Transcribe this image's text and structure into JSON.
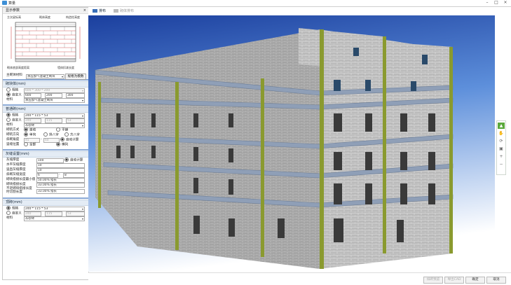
{
  "window": {
    "title": "算量"
  },
  "panel": {
    "title": "显示参数",
    "close": "×",
    "diagram_labels": {
      "top_left": "主次梁标高",
      "top_center": "砌体高度",
      "top_right": "构造柱高度",
      "bottom_left": "砌体底部高度距离",
      "bottom_right": "墙体扣减长度"
    },
    "material_label": "主砌体材料",
    "material_value": "蒸压加气混凝土砌块",
    "material_button": "规格为模数",
    "sections": {
      "masonry": {
        "title": "砌块体(mm)",
        "spec_label": "规格",
        "spec_value": "600 * 300 * 200",
        "custom_label": "自定义",
        "custom_values": [
          "600",
          "200",
          "300"
        ],
        "material_label": "材料",
        "material_value": "蒸压加气混凝土砌块"
      },
      "brick": {
        "title": "普通砖(mm)",
        "spec_label": "规格",
        "spec_value": "240 * 115 * 53",
        "custom_label": "自定义",
        "custom_values": [
          "240",
          "115",
          "53"
        ],
        "material_label": "材料",
        "material_value": "灰砂砖",
        "mode_label": "砌筑方式",
        "mode_options": [
          "自动",
          "平铺"
        ],
        "dir_label": "砌筑方向",
        "dir_options": [
          "单向",
          "斜八字",
          "方八字"
        ],
        "angle_label": "斜砌角度",
        "angle_from": "45",
        "angle_to": "60",
        "angle_auto": "自动计算",
        "layer_label": "竖缝位置",
        "layer_options": [
          "全部",
          "横列"
        ]
      },
      "mortar": {
        "title": "灰缝设置(mm)",
        "rows": [
          {
            "label": "灰缝厚度",
            "value": "100",
            "extra": "自动计算"
          },
          {
            "label": "水平灰缝厚度",
            "value": "10"
          },
          {
            "label": "竖直灰缝厚度",
            "value": "10"
          },
          {
            "label": "斜砌灰缝宽度",
            "value": "6",
            "to": "8"
          },
          {
            "label": "砌块搭接长度最小值",
            "value": "50.00% 搭长"
          },
          {
            "label": "砌块搭接长度",
            "value": "33.00% 搭长"
          },
          {
            "label": "不足砌块搭接长度时切割长度",
            "value": "33.00% 搭长"
          }
        ]
      },
      "top": {
        "title": "顶砖(mm)",
        "spec_label": "规格",
        "spec_value": "240 * 115 * 53",
        "custom_label": "自定义",
        "custom_values": [
          "240",
          "115",
          "53"
        ],
        "material_label": "材料",
        "material_value": "灰砂砖"
      }
    }
  },
  "toolbar": {
    "tab1": "排布",
    "tab2": "砌体排布"
  },
  "footer": {
    "btn1": "排砖预览",
    "btn2": "导出CAD",
    "ok": "确定",
    "cancel": "取消"
  },
  "colors": {
    "sky_top": "#1b3f9e",
    "sky_bottom": "#ffffff",
    "brick": "#b8b8b8",
    "beam": "#9aa9bd",
    "column": "#8a9a2f"
  }
}
